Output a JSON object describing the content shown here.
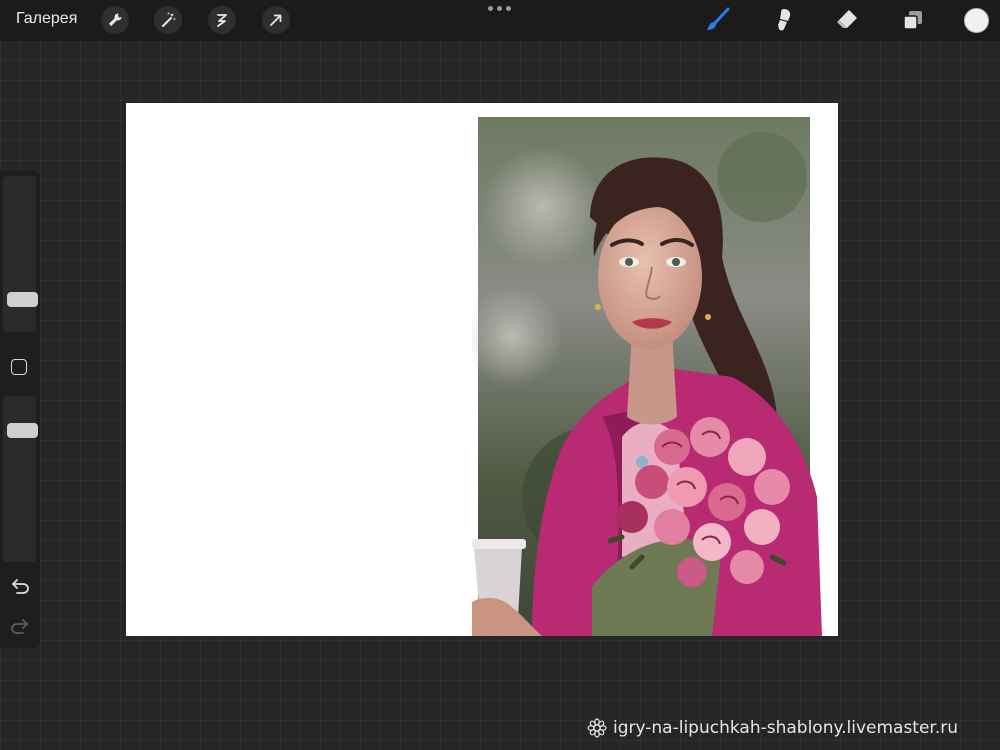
{
  "topbar": {
    "gallery_label": "Галерея",
    "left_tools": [
      {
        "icon": "wrench-icon",
        "label": "Actions"
      },
      {
        "icon": "magic-wand-icon",
        "label": "Adjustments"
      },
      {
        "icon": "selection-icon",
        "label": "Selection"
      },
      {
        "icon": "transform-arrow-icon",
        "label": "Transform"
      }
    ],
    "more_icon": "ellipsis-icon",
    "right_tools": [
      {
        "icon": "brush-icon",
        "active": true
      },
      {
        "icon": "smudge-icon"
      },
      {
        "icon": "eraser-icon"
      },
      {
        "icon": "layers-icon"
      }
    ],
    "current_color": "#f2f0f0",
    "accent_color": "#2b7bf0"
  },
  "sidebar": {
    "brush_size_level": 0.18,
    "opacity_level": 0.82,
    "modify_icon": "square-icon",
    "undo_icon": "undo-icon",
    "redo_icon": "redo-icon"
  },
  "canvas": {
    "background": "#ffffff",
    "artwork": "painted portrait of a woman in a pink coat holding a bouquet of pink roses and a coffee cup"
  },
  "watermark": {
    "text": "igry-na-lipuchkah-shablony.livemaster.ru",
    "icon": "flower-logo-icon"
  }
}
